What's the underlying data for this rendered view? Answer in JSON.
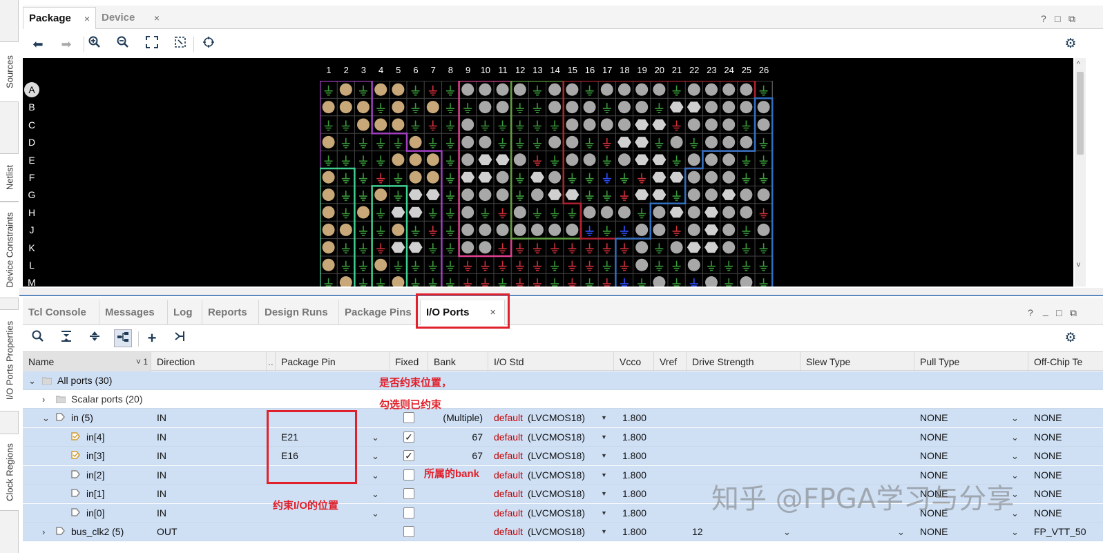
{
  "side_tabs": [
    "Sources",
    "Netlist",
    "Device Constraints",
    "I/O Ports Properties",
    "Clock Regions"
  ],
  "top_pane": {
    "tabs": [
      {
        "label": "Package"
      },
      {
        "label": "Device"
      }
    ],
    "window_controls": [
      "?",
      "□",
      "⧉"
    ],
    "column_labels": [
      "1",
      "2",
      "3",
      "4",
      "5",
      "6",
      "7",
      "8",
      "9",
      "10",
      "11",
      "12",
      "13",
      "14",
      "15",
      "16",
      "17",
      "18",
      "19",
      "20",
      "21",
      "22",
      "23",
      "24",
      "25",
      "26"
    ],
    "row_labels": [
      "A",
      "B",
      "C",
      "D",
      "E",
      "F",
      "G",
      "H",
      "J",
      "K",
      "L",
      "M"
    ]
  },
  "bottom_pane": {
    "tabs": [
      {
        "label": "Tcl Console"
      },
      {
        "label": "Messages"
      },
      {
        "label": "Log"
      },
      {
        "label": "Reports"
      },
      {
        "label": "Design Runs"
      },
      {
        "label": "Package Pins"
      },
      {
        "label": "I/O Ports"
      }
    ],
    "close_glyph": "×",
    "window_controls": [
      "?",
      "_",
      "□",
      "⧉"
    ],
    "columns": [
      "Name",
      "Direction",
      "..",
      "Package Pin",
      "Fixed",
      "Bank",
      "I/O Std",
      "Vcco",
      "Vref",
      "Drive Strength",
      "Slew Type",
      "Pull Type",
      "Off-Chip Te"
    ],
    "sort_indicator": "˅ 1",
    "rows": [
      {
        "name": "All ports (30)",
        "direction": "",
        "pin": "",
        "bank": "",
        "std_default": "",
        "std_val": "",
        "vcco": "",
        "drive": "",
        "pull": "",
        "offchip": ""
      },
      {
        "name": "Scalar ports (20)",
        "direction": "",
        "pin": "",
        "bank": "",
        "std_default": "",
        "std_val": "",
        "vcco": "",
        "drive": "",
        "pull": "",
        "offchip": ""
      },
      {
        "name": "in (5)",
        "direction": "IN",
        "pin": "",
        "bank": "(Multiple)",
        "std_default": "default",
        "std_val": "(LVCMOS18)",
        "vcco": "1.800",
        "drive": "",
        "pull": "NONE",
        "offchip": "NONE"
      },
      {
        "name": "in[4]",
        "direction": "IN",
        "pin": "E21",
        "bank": "67",
        "std_default": "default",
        "std_val": "(LVCMOS18)",
        "vcco": "1.800",
        "drive": "",
        "pull": "NONE",
        "offchip": "NONE"
      },
      {
        "name": "in[3]",
        "direction": "IN",
        "pin": "E16",
        "bank": "67",
        "std_default": "default",
        "std_val": "(LVCMOS18)",
        "vcco": "1.800",
        "drive": "",
        "pull": "NONE",
        "offchip": "NONE"
      },
      {
        "name": "in[2]",
        "direction": "IN",
        "pin": "",
        "bank": "",
        "std_default": "default",
        "std_val": "(LVCMOS18)",
        "vcco": "1.800",
        "drive": "",
        "pull": "NONE",
        "offchip": "NONE"
      },
      {
        "name": "in[1]",
        "direction": "IN",
        "pin": "",
        "bank": "",
        "std_default": "default",
        "std_val": "(LVCMOS18)",
        "vcco": "1.800",
        "drive": "",
        "pull": "NONE",
        "offchip": "NONE"
      },
      {
        "name": "in[0]",
        "direction": "IN",
        "pin": "",
        "bank": "",
        "std_default": "default",
        "std_val": "(LVCMOS18)",
        "vcco": "1.800",
        "drive": "",
        "pull": "NONE",
        "offchip": "NONE"
      },
      {
        "name": "bus_clk2 (5)",
        "direction": "OUT",
        "pin": "",
        "bank": "",
        "std_default": "default",
        "std_val": "(LVCMOS18)",
        "vcco": "1.800",
        "drive": "12",
        "pull": "NONE",
        "offchip": "FP_VTT_50"
      }
    ]
  },
  "annotations": {
    "fixed_note_line1": "是否约束位置，",
    "fixed_note_line2": "勾选则已约束",
    "bank_note": "所属的bank",
    "pin_note": "约束I/O的位置"
  },
  "watermark": "知乎 @FPGA学习与分享",
  "colors": {
    "annotation": "#e0202a",
    "selection": "#cfe0f5",
    "default_std": "#c00000"
  }
}
